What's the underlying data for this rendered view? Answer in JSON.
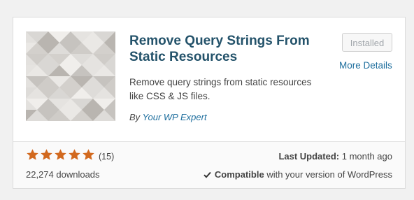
{
  "plugin": {
    "title": "Remove Query Strings From Static Resources",
    "description": "Remove query strings from static resources like CSS & JS files.",
    "author_prefix": "By ",
    "author_name": "Your WP Expert",
    "installed_label": "Installed",
    "more_details_label": "More Details"
  },
  "footer": {
    "rating_stars": 5,
    "num_ratings": "(15)",
    "downloads": "22,274 downloads",
    "last_updated_label": "Last Updated:",
    "last_updated_value": " 1 month ago",
    "compatible_label": "Compatible",
    "compatible_text": " with your version of WordPress"
  },
  "colors": {
    "title": "#23526a",
    "link": "#1f6f9e",
    "star": "#d2691e"
  },
  "icons": {
    "star": "star-icon",
    "check": "checkmark-icon",
    "thumbnail": "geometric-triangles-pattern"
  }
}
